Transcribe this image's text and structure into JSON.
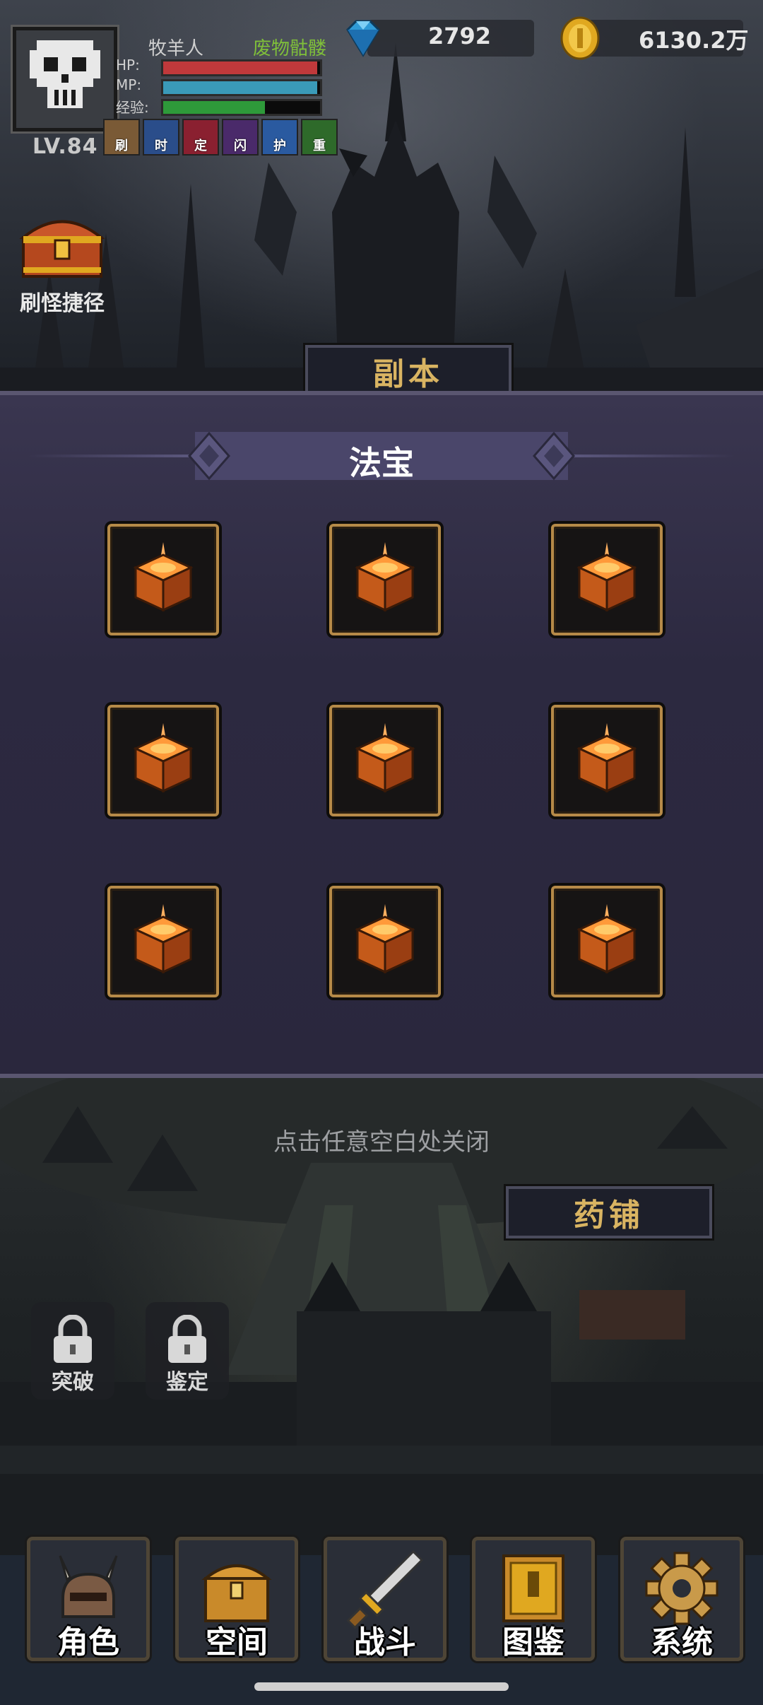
{
  "player": {
    "name": "牧羊人",
    "level": "LV.84",
    "target": "废物骷髅",
    "hp_label": "HP:",
    "mp_label": "MP:",
    "exp_label": "经验:",
    "hp_fraction": 0.98,
    "mp_fraction": 0.98,
    "exp_fraction": 0.65,
    "buffs": [
      "刷",
      "时",
      "定",
      "闪",
      "护",
      "重"
    ]
  },
  "currency": {
    "gems": "2792",
    "gold": "6130.2万"
  },
  "shortcut": {
    "label": "刷怪捷径"
  },
  "signs": {
    "dungeon": "副本",
    "pharmacy": "药铺"
  },
  "panel": {
    "title": "法宝",
    "slot_count": 9
  },
  "hint": "点击任意空白处关闭",
  "locked": [
    {
      "label": "突破"
    },
    {
      "label": "鉴定"
    }
  ],
  "nav": [
    {
      "label": "角色",
      "icon": "helmet-icon"
    },
    {
      "label": "空间",
      "icon": "chest-icon"
    },
    {
      "label": "战斗",
      "icon": "sword-icon"
    },
    {
      "label": "图鉴",
      "icon": "book-icon"
    },
    {
      "label": "系统",
      "icon": "gear-icon"
    }
  ],
  "colors": {
    "hp": "#c0393b",
    "mp": "#3a9ab8",
    "exp": "#2e9a3a",
    "slot_border": "#b68a48",
    "panel_bg": "#2c2940"
  }
}
